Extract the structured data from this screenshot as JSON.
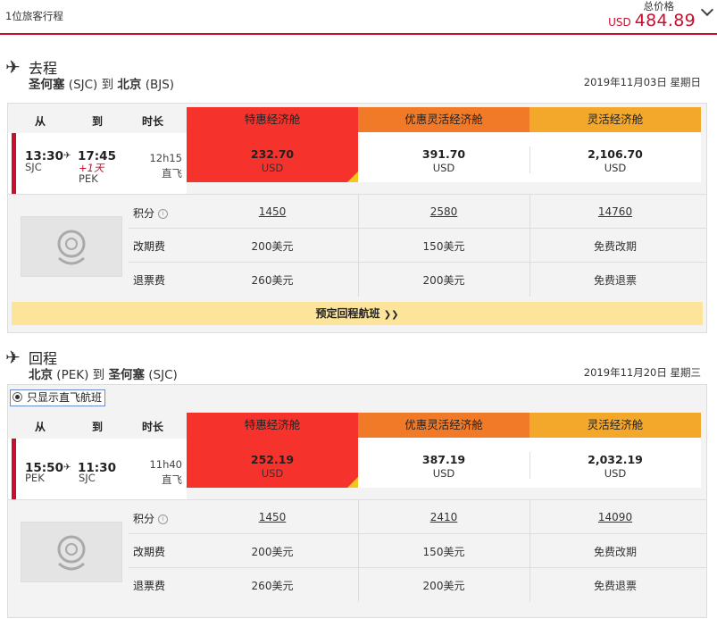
{
  "header": {
    "travelers": "1位旅客行程",
    "total_label": "总价格",
    "currency": "USD",
    "total": "484.89"
  },
  "columns": {
    "from": "从",
    "to": "到",
    "duration": "时长"
  },
  "fare_names": [
    "特惠经济舱",
    "优惠灵活经济舱",
    "灵活经济舱"
  ],
  "outbound": {
    "title": "去程",
    "route_from_city": "圣何塞",
    "route_from_code": "(SJC)",
    "route_to_word": "到",
    "route_to_city": "北京",
    "route_to_code": "(BJS)",
    "date": "2019年11月03日 星期日",
    "depart_time": "13:30",
    "arrive_time": "17:45",
    "depart_code": "SJC",
    "day_offset": "+1天",
    "arrive_code": "PEK",
    "duration": "12h15",
    "stops": "直飞",
    "fares": [
      {
        "price": "232.70",
        "currency": "USD",
        "points": "1450",
        "change_fee": "200美元",
        "refund_fee": "260美元"
      },
      {
        "price": "391.70",
        "currency": "USD",
        "points": "2580",
        "change_fee": "150美元",
        "refund_fee": "200美元"
      },
      {
        "price": "2,106.70",
        "currency": "USD",
        "points": "14760",
        "change_fee": "免费改期",
        "refund_fee": "免费退票"
      }
    ],
    "book_return": "预定回程航班"
  },
  "inbound": {
    "title": "回程",
    "route_from_city": "北京",
    "route_from_code": "(PEK)",
    "route_to_word": "到",
    "route_to_city": "圣何塞",
    "route_to_code": "(SJC)",
    "date": "2019年11月20日 星期三",
    "filter_label": "只显示直飞航班",
    "depart_time": "15:50",
    "arrive_time": "11:30",
    "depart_code": "PEK",
    "arrive_code": "SJC",
    "duration": "11h40",
    "stops": "直飞",
    "fares": [
      {
        "price": "252.19",
        "currency": "USD",
        "points": "1450",
        "change_fee": "200美元",
        "refund_fee": "260美元"
      },
      {
        "price": "387.19",
        "currency": "USD",
        "points": "2410",
        "change_fee": "150美元",
        "refund_fee": "200美元"
      },
      {
        "price": "2,032.19",
        "currency": "USD",
        "points": "14090",
        "change_fee": "免费改期",
        "refund_fee": "免费退票"
      }
    ]
  },
  "row_labels": {
    "points": "积分",
    "change": "改期费",
    "refund": "退票费"
  },
  "colors": {
    "accent_red": "#c8102e",
    "tab1": "#f5332c",
    "tab2": "#f07a28",
    "tab3": "#f3a72b",
    "book_bar": "#fde49b"
  }
}
